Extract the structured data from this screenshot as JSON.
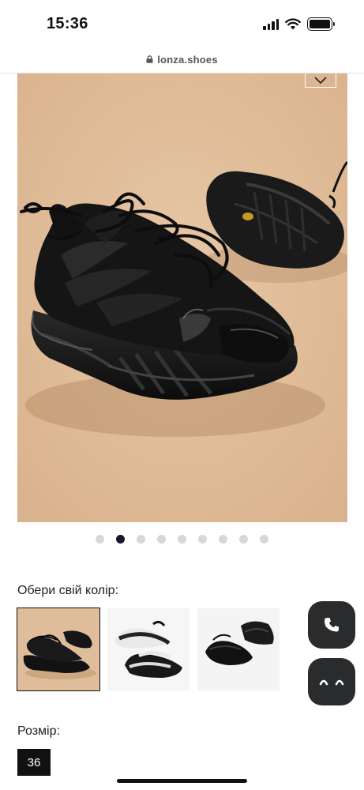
{
  "status_bar": {
    "time": "15:36",
    "icons": [
      "signal-icon",
      "wifi-icon",
      "battery-icon"
    ]
  },
  "browser": {
    "url": "lonza.shoes",
    "icon": "lock-icon"
  },
  "gallery": {
    "image": "black-chunky-sneaker-photo",
    "favorite_icon": "chevron-down-icon",
    "dots_total": 9,
    "active_dot": 2
  },
  "color_picker": {
    "label": "Обери свій колір:",
    "swatches": [
      {
        "name": "black",
        "selected": true
      },
      {
        "name": "white-black",
        "selected": false
      },
      {
        "name": "black-pair",
        "selected": false
      }
    ]
  },
  "size_picker": {
    "label": "Розмір:",
    "selected_size": "36"
  },
  "floating_actions": {
    "phone_icon": "phone-icon",
    "chat_icon": "chat-face-icon"
  },
  "colors": {
    "background": "#e2bf9d",
    "dot_active": "#15172b",
    "dot_inactive": "#d7d7d7",
    "fab": "#2a2b2d",
    "chip": "#111111"
  }
}
